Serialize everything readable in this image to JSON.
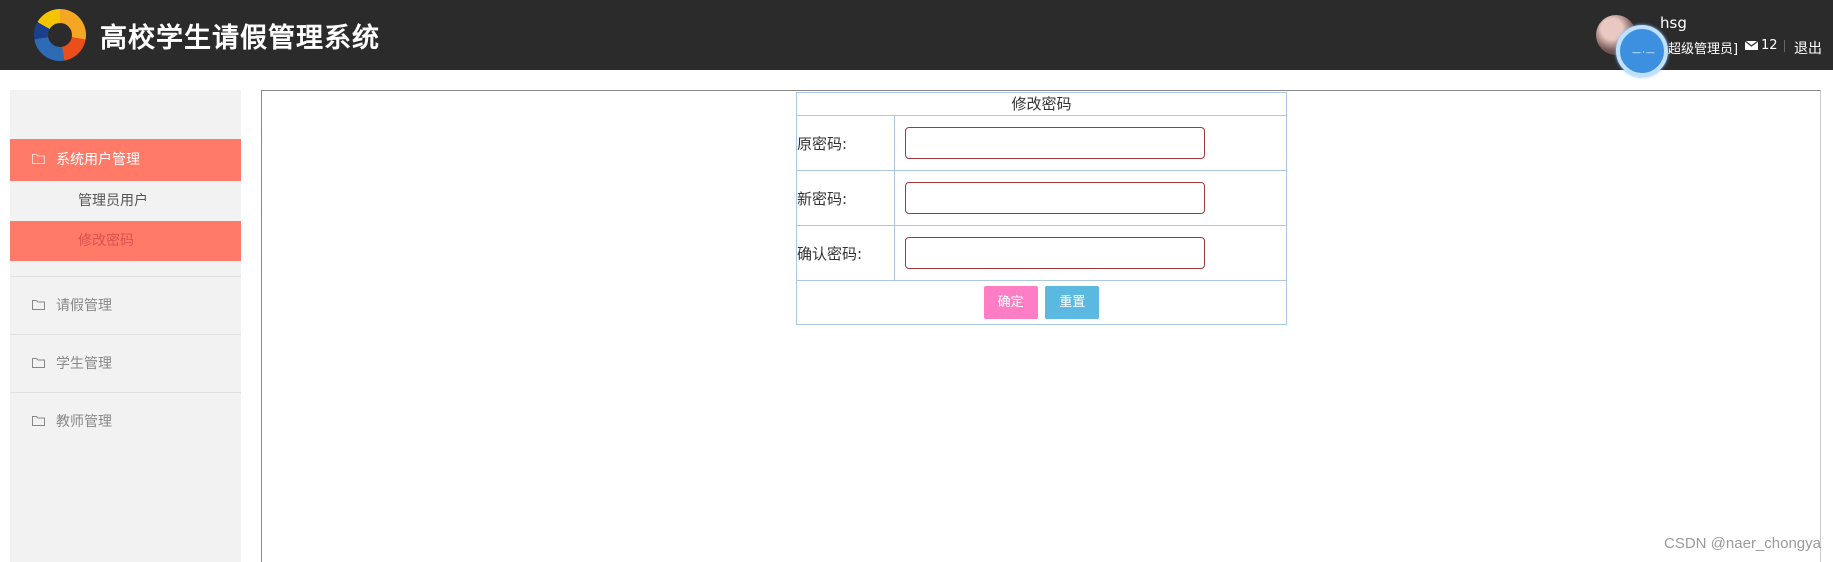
{
  "header": {
    "title": "高校学生请假管理系统",
    "user_name": "hsg",
    "user_role": "超级管理员]",
    "messages_count": "12",
    "logout_label": "退出",
    "overlay_text": "—·—"
  },
  "sidebar": {
    "groups": [
      {
        "label": "系统用户管理",
        "icon": "folder-icon",
        "expanded": true,
        "items": [
          {
            "label": "管理员用户",
            "active": false
          },
          {
            "label": "修改密码",
            "active": true
          }
        ]
      },
      {
        "label": "请假管理",
        "icon": "folder-icon"
      },
      {
        "label": "学生管理",
        "icon": "folder-icon"
      },
      {
        "label": "教师管理",
        "icon": "folder-icon"
      }
    ]
  },
  "form": {
    "caption": "修改密码",
    "fields": [
      {
        "label": "原密码:",
        "value": ""
      },
      {
        "label": "新密码:",
        "value": ""
      },
      {
        "label": "确认密码:",
        "value": ""
      }
    ],
    "submit_label": "确定",
    "reset_label": "重置"
  },
  "watermark": "CSDN @naer_chongya",
  "colors": {
    "header_bg": "#2b2b2b",
    "sidebar_bg": "#f2f2f2",
    "active_menu": "#ff7b67",
    "submit_button": "#ff7dc4",
    "reset_button": "#5bb8e0",
    "table_border": "#aac8e4"
  }
}
